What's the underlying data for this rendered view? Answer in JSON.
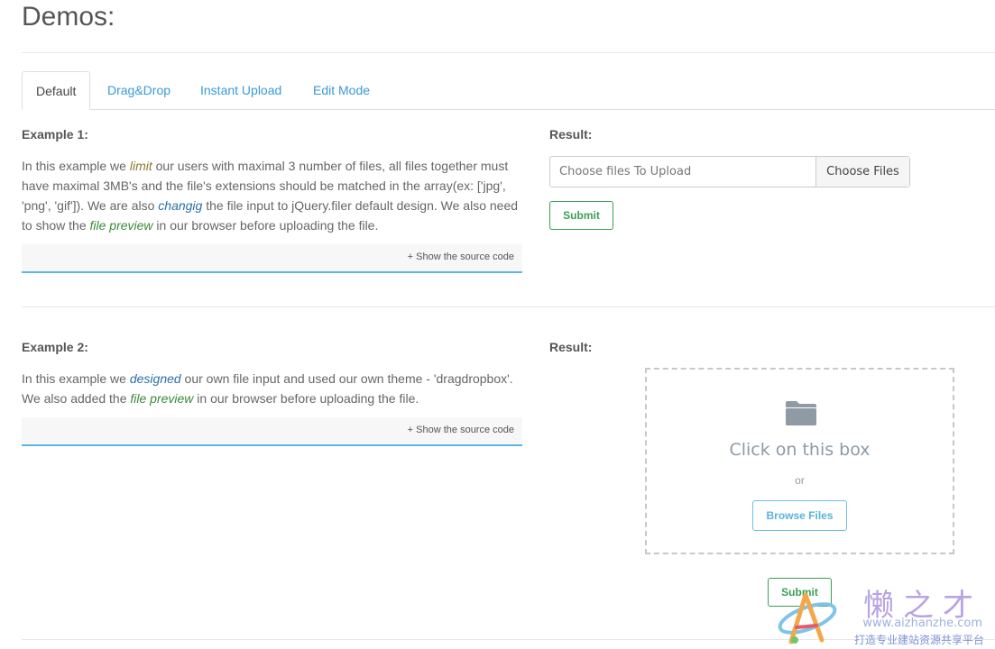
{
  "page": {
    "title": "Demos:"
  },
  "tabs": [
    {
      "label": "Default",
      "active": true
    },
    {
      "label": "Drag&Drop",
      "active": false
    },
    {
      "label": "Instant Upload",
      "active": false
    },
    {
      "label": "Edit Mode",
      "active": false
    }
  ],
  "example1": {
    "heading": "Example 1:",
    "text": {
      "p1": "In this example we ",
      "em1": "limit",
      "p2": " our users with maximal 3 number of files, all files together must have maximal 3MB's and the file's extensions should be matched in the array(ex: ['jpg', 'png', 'gif']). We are also ",
      "em2": "changig",
      "p3": " the file input to jQuery.filer default design. We also need to show the ",
      "em3": "file preview",
      "p4": " in our browser before uploading the file."
    },
    "source_link": "+ Show the source code",
    "result_heading": "Result:",
    "input_placeholder": "Choose files To Upload",
    "choose_button": "Choose Files",
    "submit_button": "Submit"
  },
  "example2": {
    "heading": "Example 2:",
    "text": {
      "p1": "In this example we ",
      "em1": "designed",
      "p2": " our own file input and used our own theme - 'dragdropbox'. We also added the ",
      "em2": "file preview",
      "p3": " in our browser before uploading the file."
    },
    "source_link": "+ Show the source code",
    "result_heading": "Result:",
    "dropbox_title": "Click on this box",
    "dropbox_or": "or",
    "browse_button": "Browse Files",
    "submit_button": "Submit",
    "folder_icon": "folder-icon"
  },
  "watermark": {
    "brand": "懒之才",
    "url": "www.aizhanzhe.com",
    "tagline": "打造专业建站资源共享平台"
  },
  "colors": {
    "link": "#3a9ad9",
    "submit_green": "#3a9e55",
    "browse_blue": "#5ab3dc",
    "source_underline": "#5bb8e6"
  }
}
